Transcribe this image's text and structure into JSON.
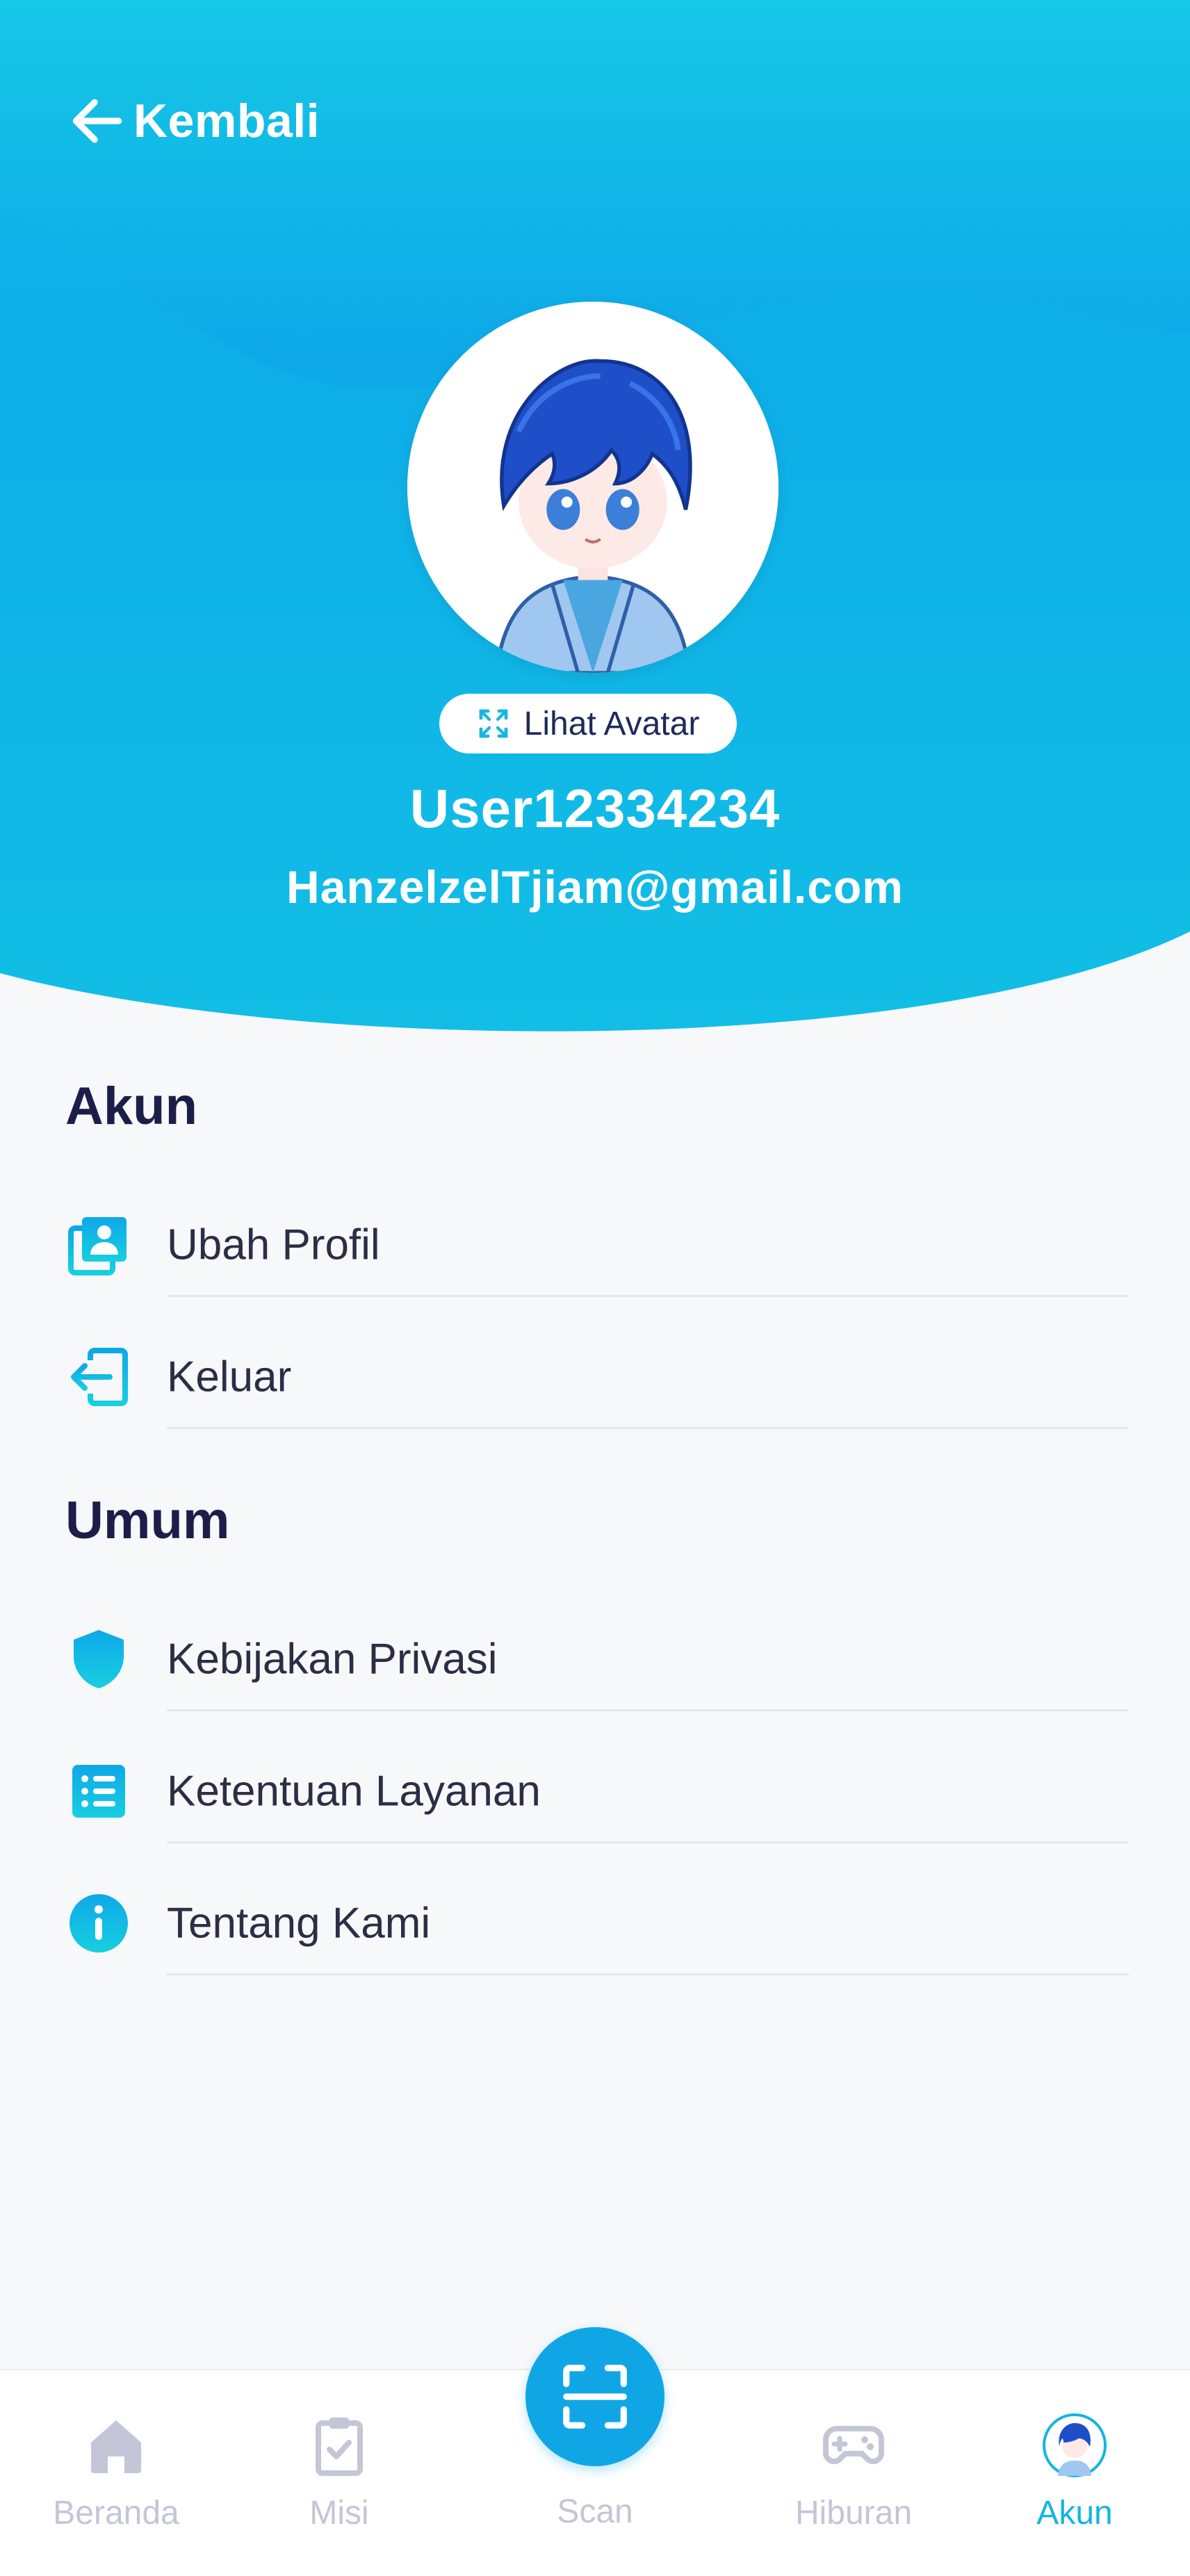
{
  "colors": {
    "header_gradient_top": "#17c6e6",
    "header_gradient_mid": "#0ea8e8",
    "accent": "#10a6e6",
    "title_text": "#1c1e4a",
    "nav_inactive": "#c2c6d6",
    "nav_active": "#14b5e0"
  },
  "header": {
    "back_label": "Kembali",
    "back_icon": "arrow-left-icon",
    "avatar_button_label": "Lihat Avatar",
    "username": "User12334234",
    "email": "HanzelzelTjiam@gmail.com"
  },
  "sections": [
    {
      "title": "Akun",
      "items": [
        {
          "label": "Ubah Profil",
          "icon": "profile-card-icon"
        },
        {
          "label": "Keluar",
          "icon": "logout-icon"
        }
      ]
    },
    {
      "title": "Umum",
      "items": [
        {
          "label": "Kebijakan Privasi",
          "icon": "shield-icon"
        },
        {
          "label": "Ketentuan Layanan",
          "icon": "list-icon"
        },
        {
          "label": "Tentang Kami",
          "icon": "info-icon"
        }
      ]
    }
  ],
  "bottom_nav": {
    "items": [
      {
        "label": "Beranda",
        "icon": "home-icon",
        "active": false
      },
      {
        "label": "Misi",
        "icon": "clipboard-check-icon",
        "active": false
      },
      {
        "label": "Scan",
        "icon": "scan-icon",
        "active": false
      },
      {
        "label": "Hiburan",
        "icon": "gamepad-icon",
        "active": false
      },
      {
        "label": "Akun",
        "icon": "avatar-icon",
        "active": true
      }
    ]
  }
}
